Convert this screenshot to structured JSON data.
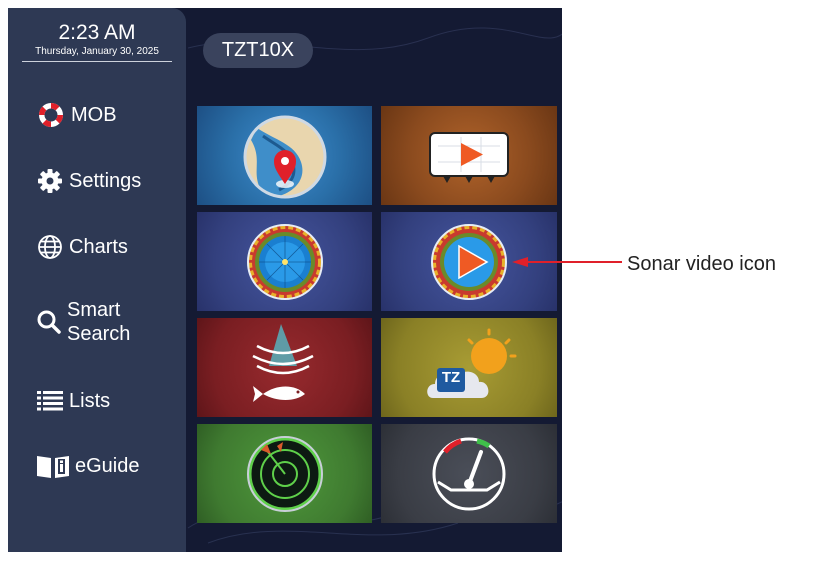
{
  "clock": {
    "time": "2:23 AM",
    "date": "Thursday, January 30, 2025"
  },
  "model": "TZT10X",
  "sidebar": {
    "items": [
      {
        "label": "MOB",
        "icon": "lifebuoy-icon"
      },
      {
        "label": "Settings",
        "icon": "gear-icon"
      },
      {
        "label": "Charts",
        "icon": "globe-icon"
      },
      {
        "label_line1": "Smart",
        "label_line2": "Search",
        "icon": "search-icon"
      },
      {
        "label": "Lists",
        "icon": "list-icon"
      },
      {
        "label": "eGuide",
        "icon": "book-icon"
      }
    ]
  },
  "tiles": [
    {
      "name": "chart-plotter-app",
      "icon": "map-pin-icon"
    },
    {
      "name": "video-app",
      "icon": "video-play-icon"
    },
    {
      "name": "sonar-app",
      "icon": "sonar-icon"
    },
    {
      "name": "sonar-video-app",
      "icon": "sonar-video-icon"
    },
    {
      "name": "fish-finder-app",
      "icon": "fish-finder-icon"
    },
    {
      "name": "timezero-weather-app",
      "icon": "weather-icon",
      "logo_text": "TZ"
    },
    {
      "name": "radar-app",
      "icon": "radar-icon"
    },
    {
      "name": "instruments-app",
      "icon": "gauge-icon"
    }
  ],
  "callout": {
    "text": "Sonar video icon"
  },
  "colors": {
    "screen_bg": "#141a33",
    "sidebar_bg": "#2e3954",
    "tile_chart": "#2a6fa8",
    "tile_video": "#8a4a1e",
    "tile_sonar": "#33407e",
    "tile_fish": "#7a1e22",
    "tile_weather": "#8a8026",
    "tile_radar": "#3f7a30",
    "tile_gauge": "#3a3d45",
    "callout": "#e0202a"
  }
}
